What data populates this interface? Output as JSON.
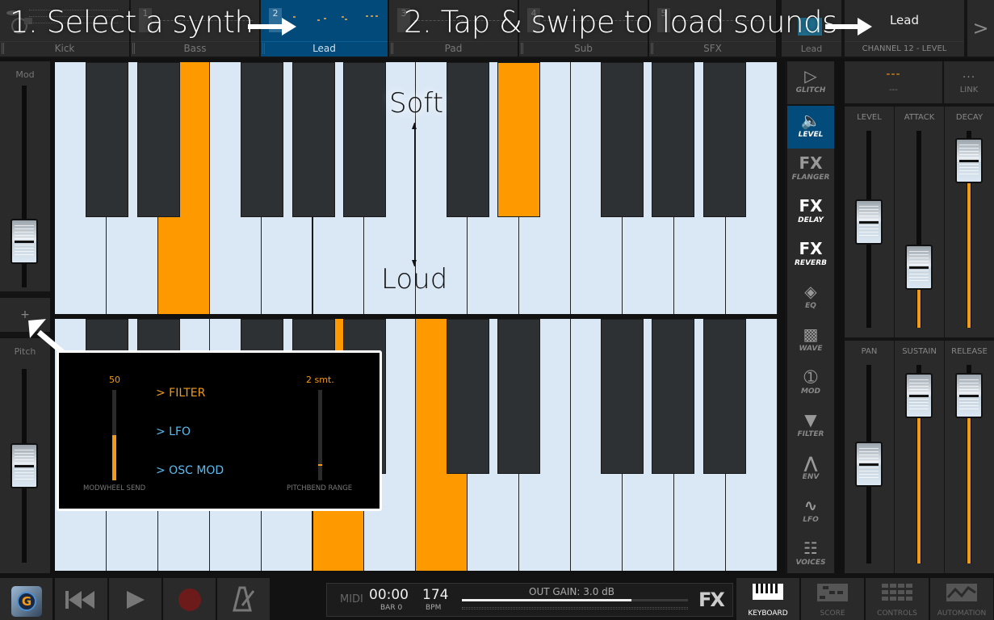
{
  "tracks": [
    {
      "label": "Kick",
      "number": "",
      "active": false
    },
    {
      "label": "Bass",
      "number": "1",
      "active": false
    },
    {
      "label": "Lead",
      "number": "2",
      "active": true
    },
    {
      "label": "Pad",
      "number": "3",
      "active": false
    },
    {
      "label": "Sub",
      "number": "4",
      "active": false
    },
    {
      "label": "SFX",
      "number": "5",
      "active": false
    }
  ],
  "instrument_tab": {
    "label": "Lead"
  },
  "preset": {
    "name": "Lead",
    "channel": "CHANNEL 12 - LEVEL",
    "next_label": ">"
  },
  "annotations": {
    "step1": "1. Select a synth",
    "step2": "2. Tap & swipe to load sounds",
    "soft": "Soft",
    "loud": "Loud"
  },
  "left_strip": {
    "mod_label": "Mod",
    "mod_value": 0.15,
    "plus_label": "+",
    "pitch_label": "Pitch",
    "pitch_value": 0.5
  },
  "keyboards": {
    "upper": {
      "white_pressed": [
        2
      ],
      "black_pressed": [
        6
      ]
    },
    "lower": {
      "white_pressed": [
        5,
        7
      ],
      "black_pressed": []
    }
  },
  "popup": {
    "modwheel_value": "50",
    "modwheel_fraction": 0.5,
    "modwheel_caption": "MODWHEEL SEND",
    "pitchbend_value": "2 smt.",
    "pitchbend_fraction": 0.16,
    "pitchbend_caption": "PITCHBEND RANGE",
    "options": [
      {
        "label": "> FILTER",
        "selected": true
      },
      {
        "label": "> LFO",
        "selected": false
      },
      {
        "label": "> OSC MOD",
        "selected": false
      }
    ]
  },
  "right_nav": [
    {
      "icon": "glitch",
      "label": "GLITCH",
      "active": false
    },
    {
      "icon": "speaker",
      "label": "LEVEL",
      "active": true
    },
    {
      "icon": "fx",
      "label": "FLANGER",
      "active": false
    },
    {
      "icon": "fx",
      "label": "DELAY",
      "active": false
    },
    {
      "icon": "fx",
      "label": "REVERB",
      "active": false
    },
    {
      "icon": "eq",
      "label": "EQ",
      "active": false
    },
    {
      "icon": "wave",
      "label": "WAVE",
      "active": false
    },
    {
      "icon": "mod",
      "label": "MOD",
      "active": false
    },
    {
      "icon": "filter",
      "label": "FILTER",
      "active": false
    },
    {
      "icon": "env",
      "label": "ENV",
      "active": false
    },
    {
      "icon": "lfo",
      "label": "LFO",
      "active": false
    },
    {
      "icon": "voices",
      "label": "VOICES",
      "active": false
    }
  ],
  "param_header": {
    "value": "---",
    "sub": "---",
    "link_value": "...",
    "link_label": "LINK"
  },
  "params": [
    {
      "label": "LEVEL",
      "value": 0.55,
      "show_fill": false
    },
    {
      "label": "ATTACK",
      "value": 0.25,
      "show_fill": true
    },
    {
      "label": "DECAY",
      "value": 0.95,
      "show_fill": true
    },
    {
      "label": "PAN",
      "value": 0.5,
      "show_fill": false
    },
    {
      "label": "SUSTAIN",
      "value": 0.95,
      "show_fill": true
    },
    {
      "label": "RELEASE",
      "value": 0.95,
      "show_fill": true
    }
  ],
  "transport": {
    "midi": "MIDI",
    "time": "00:00",
    "bar": "BAR 0",
    "bpm": "174",
    "bpm_label": "BPM",
    "gain": "OUT GAIN: 3.0 dB",
    "gain_fraction": 0.75,
    "fx": "FX"
  },
  "views": [
    {
      "label": "KEYBOARD",
      "active": true
    },
    {
      "label": "SCORE",
      "active": false
    },
    {
      "label": "CONTROLS",
      "active": false
    },
    {
      "label": "AUTOMATION",
      "active": false
    }
  ],
  "colors": {
    "accent": "#ff9900",
    "active_blue": "#034b7a",
    "link_blue": "#5bbcf2"
  }
}
